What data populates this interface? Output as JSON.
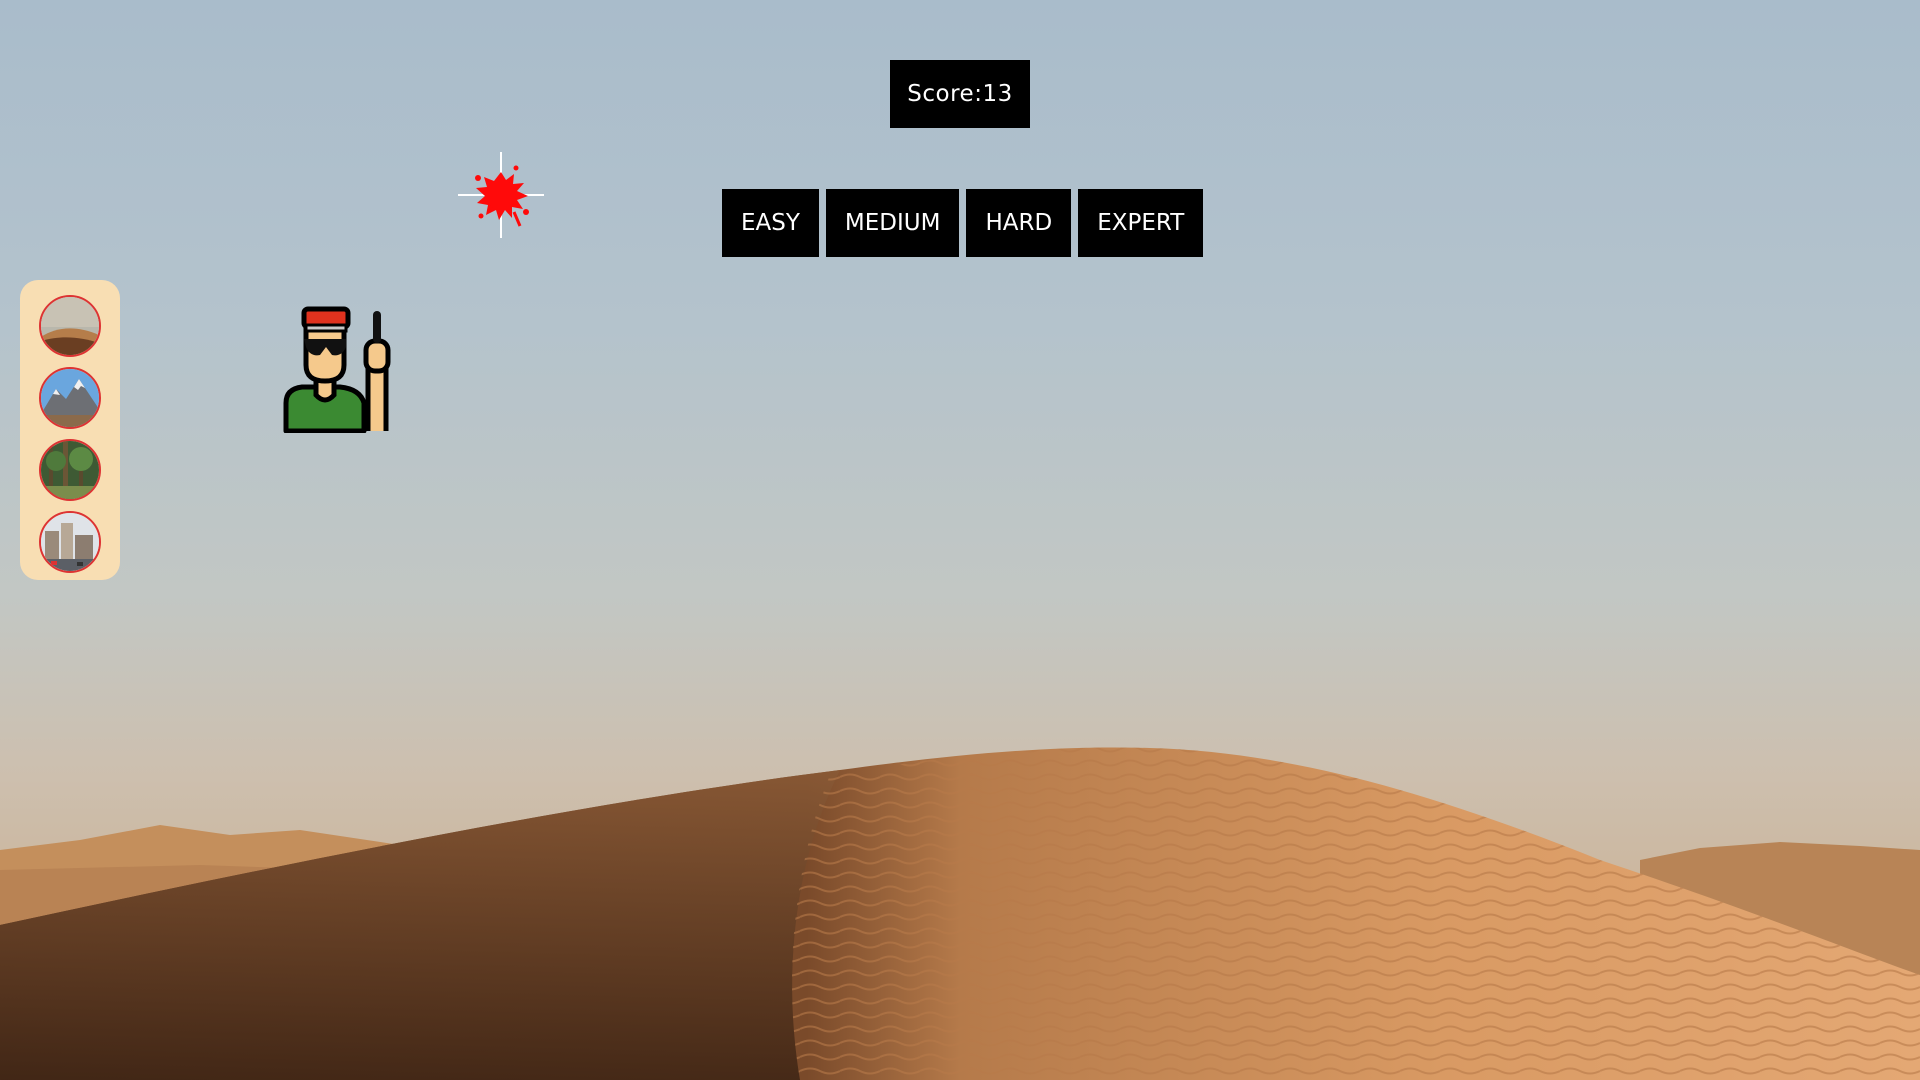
{
  "score": {
    "text": "Score:13"
  },
  "levels": [
    {
      "label": "EASY"
    },
    {
      "label": "MEDIUM"
    },
    {
      "label": "HARD"
    },
    {
      "label": "EXPERT"
    }
  ],
  "backgrounds": [
    {
      "name": "desert"
    },
    {
      "name": "mountains"
    },
    {
      "name": "forest"
    },
    {
      "name": "city"
    }
  ],
  "colors": {
    "button_bg": "#000000",
    "button_text": "#ffffff",
    "sidebar_bg": "#f8deb3",
    "thumb_border": "#dd3333",
    "splat": "#ff0000",
    "target_shirt": "#3b8a32",
    "target_hat": "#e0321e",
    "target_skin": "#f5c98c"
  },
  "icons": {
    "target": "soldier-icon",
    "hit_marker": "blood-splat-icon"
  }
}
